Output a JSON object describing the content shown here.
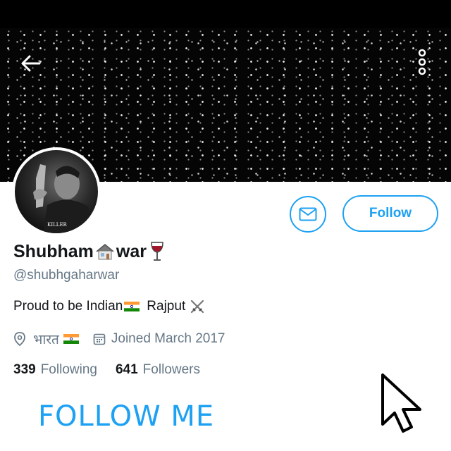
{
  "header": {
    "back_icon": "arrow-left-icon",
    "more_icon": "vertical-dots-icon"
  },
  "profile": {
    "name_part1": "Shubham",
    "name_part2": "war",
    "handle": "@shubhgaharwar",
    "bio_part1": "Proud to be Indian",
    "bio_part2": "Rajput",
    "location": "भारत",
    "joined": "Joined March 2017",
    "avatar_caption": "KILLER"
  },
  "stats": {
    "following_count": "339",
    "following_label": "Following",
    "followers_count": "641",
    "followers_label": "Followers"
  },
  "actions": {
    "follow_label": "Follow",
    "message_icon": "envelope-icon"
  },
  "overlay": {
    "follow_me_text": "FOLLOW ME",
    "cursor_icon": "mouse-pointer-icon"
  },
  "colors": {
    "accent": "#1da1f2",
    "secondary_text": "#657786",
    "primary_text": "#14171a",
    "banner": "#050505"
  }
}
